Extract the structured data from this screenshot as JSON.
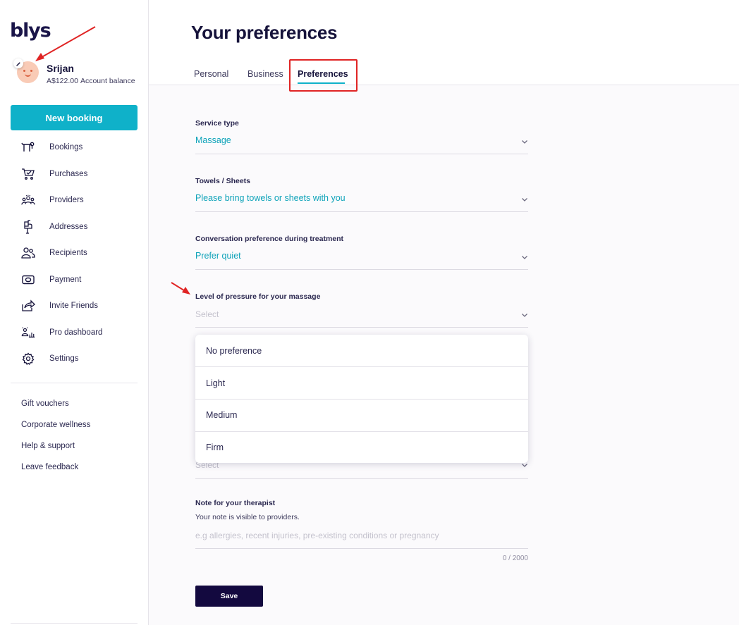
{
  "brand": {
    "logo_text": "blys",
    "accent_color": "#0fb1c9",
    "primary_color": "#13093f"
  },
  "user": {
    "name": "Srijan",
    "balance": "A$122.00",
    "balance_label": "Account balance",
    "avatar_icon": "avatar-face",
    "edit_icon": "pencil-icon"
  },
  "sidebar": {
    "new_booking_label": "New booking",
    "nav_items": [
      {
        "label": "Bookings",
        "icon": "bookings-icon"
      },
      {
        "label": "Purchases",
        "icon": "cart-icon"
      },
      {
        "label": "Providers",
        "icon": "providers-icon"
      },
      {
        "label": "Addresses",
        "icon": "mailbox-icon"
      },
      {
        "label": "Recipients",
        "icon": "recipients-icon"
      },
      {
        "label": "Payment",
        "icon": "payment-icon"
      },
      {
        "label": "Invite Friends",
        "icon": "share-icon"
      },
      {
        "label": "Pro dashboard",
        "icon": "dashboard-icon"
      },
      {
        "label": "Settings",
        "icon": "gear-icon"
      }
    ],
    "links": [
      "Gift vouchers",
      "Corporate wellness",
      "Help & support",
      "Leave feedback"
    ]
  },
  "header": {
    "title": "Your preferences",
    "tabs": [
      {
        "label": "Personal",
        "active": false
      },
      {
        "label": "Business",
        "active": false
      },
      {
        "label": "Preferences",
        "active": true
      }
    ]
  },
  "form": {
    "service_type": {
      "label": "Service type",
      "value": "Massage"
    },
    "towels": {
      "label": "Towels / Sheets",
      "value": "Please bring towels or sheets with you"
    },
    "conversation": {
      "label": "Conversation preference during treatment",
      "value": "Prefer quiet"
    },
    "pressure": {
      "label": "Level of pressure for your massage",
      "placeholder": "Select",
      "options": [
        "No preference",
        "Light",
        "Medium",
        "Firm"
      ]
    },
    "hidden_select": {
      "placeholder": "Select"
    },
    "note": {
      "label": "Note for your therapist",
      "sublabel": "Your note is visible to providers.",
      "placeholder": "e.g allergies, recent injuries, pre-existing conditions or pregnancy",
      "counter": "0 / 2000"
    },
    "save_label": "Save"
  }
}
